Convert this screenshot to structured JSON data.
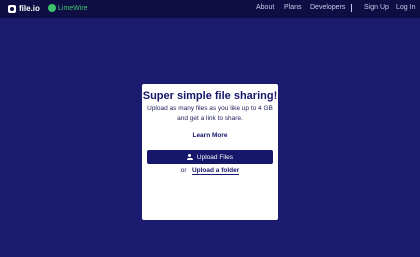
{
  "nav": {
    "logo_text": "file.io",
    "partner_text": "LimeWire",
    "links": [
      "About",
      "Plans",
      "Developers"
    ],
    "account_links": [
      "Sign Up",
      "Log In"
    ]
  },
  "card": {
    "title": "Super simple file sharing!",
    "description": "Upload as many files as you like up to 4 GB and get a link to share.",
    "learn_more": "Learn More",
    "upload_button": "Upload Files",
    "or_text": "or",
    "upload_folder": "Upload a folder"
  },
  "colors": {
    "background": "#1b1b6f",
    "navbar": "#0e0e45",
    "accent": "#16166b",
    "partner": "#3ec46d"
  }
}
